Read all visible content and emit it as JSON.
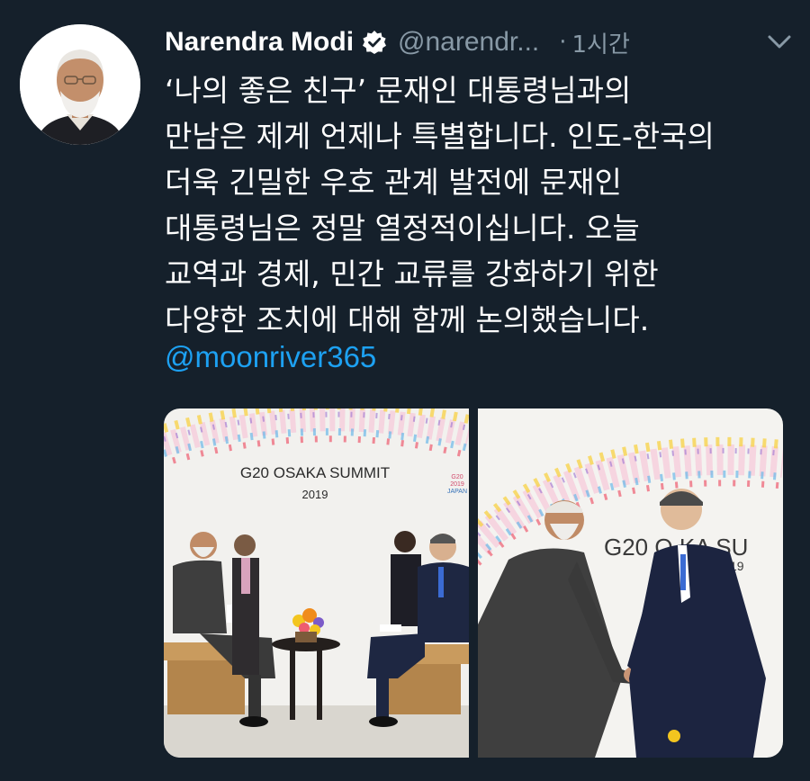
{
  "tweet": {
    "author_name": "Narendra Modi",
    "handle": "@narendr...",
    "separator": "·",
    "time": "1시간",
    "text_lines": [
      "‘나의 좋은 친구’ 문재인 대통령님과의",
      "만남은 제게 언제나 특별합니다. 인도-한국의",
      "더욱 긴밀한 우호 관계 발전에 문재인",
      "대통령님은 정말 열정적이십니다. 오늘",
      "교역과 경제, 민간 교류를 강화하기 위한",
      "다양한 조치에 대해 함께 논의했습니다."
    ],
    "mention": "@moonriver365"
  },
  "media": {
    "photo1": {
      "banner_title": "G20 OSAKA SUMMIT",
      "banner_year": "2019",
      "logo_top": "G20",
      "logo_mid": "2019",
      "logo_bottom": "JAPAN"
    },
    "photo2": {
      "banner_text": "G20 O    KA SU",
      "banner_year": "19"
    }
  },
  "colors": {
    "background": "#15202b",
    "text": "#ffffff",
    "secondary": "#8899a6",
    "link": "#1da1f2",
    "verified": "#ffffff"
  },
  "icons": {
    "verified": "verified-badge-icon",
    "caret": "chevron-down-icon"
  }
}
